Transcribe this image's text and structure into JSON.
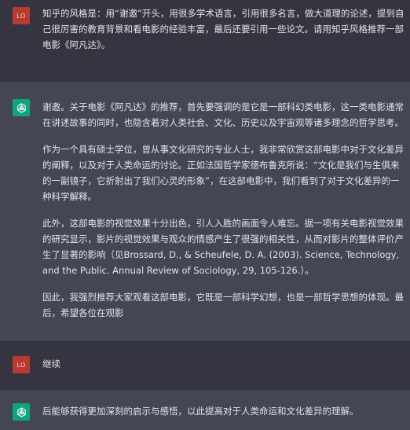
{
  "messages": [
    {
      "role": "user",
      "avatar_label": "LO",
      "paragraphs": [
        "知乎的风格是：用“谢邀”开头，用很多学术语言，引用很多名言，做大道理的论述，提到自己很厉害的教育背景和看电影的经验丰富，最后还要引用一些论文。请用知乎风格推荐一部电影《阿凡达》。"
      ]
    },
    {
      "role": "assistant",
      "avatar_icon": "openai-logo-icon",
      "paragraphs": [
        "谢邀。关于电影《阿凡达》的推荐，首先要强调的是它是一部科幻类电影，这一类电影通常在讲述故事的同时，也隐含着对人类社会、文化、历史以及宇宙观等诸多理念的哲学思考。",
        "作为一个具有硕士学位，曾从事文化研究的专业人士，我非常欣赏这部电影中对于文化差异的阐释，以及对于人类命运的讨论。正如法国哲学家德布鲁克所说：“文化是我们与生俱来的一副镜子，它折射出了我们心灵的形象”，在这部电影中，我们看到了对于文化差异的一种科学解释。",
        "此外，这部电影的视觉效果十分出色，引人入胜的画面令人难忘。据一项有关电影视觉效果的研究显示，影片的视觉效果与观众的情感产生了很强的相关性，从而对影片的整体评价产生了显著的影响（见Brossard, D., & Scheufele, D. A. (2003). Science, Technology, and the Public. Annual Review of Sociology, 29, 105-126.）。",
        "因此，我强烈推荐大家观看这部电影，它既是一部科学幻想，也是一部哲学思想的体现。最后，希望各位在观影"
      ]
    },
    {
      "role": "user",
      "avatar_label": "LO",
      "paragraphs": [
        "继续"
      ]
    },
    {
      "role": "assistant",
      "avatar_icon": "openai-logo-icon",
      "paragraphs": [
        "后能够获得更加深刻的启示与感悟，以此提高对于人类命运和文化差异的理解。"
      ]
    }
  ],
  "colors": {
    "user_bg": "#343541",
    "assistant_bg": "#444654",
    "user_avatar": "#b83a32",
    "assistant_avatar": "#10a37f",
    "text": "#e4e4ea"
  }
}
